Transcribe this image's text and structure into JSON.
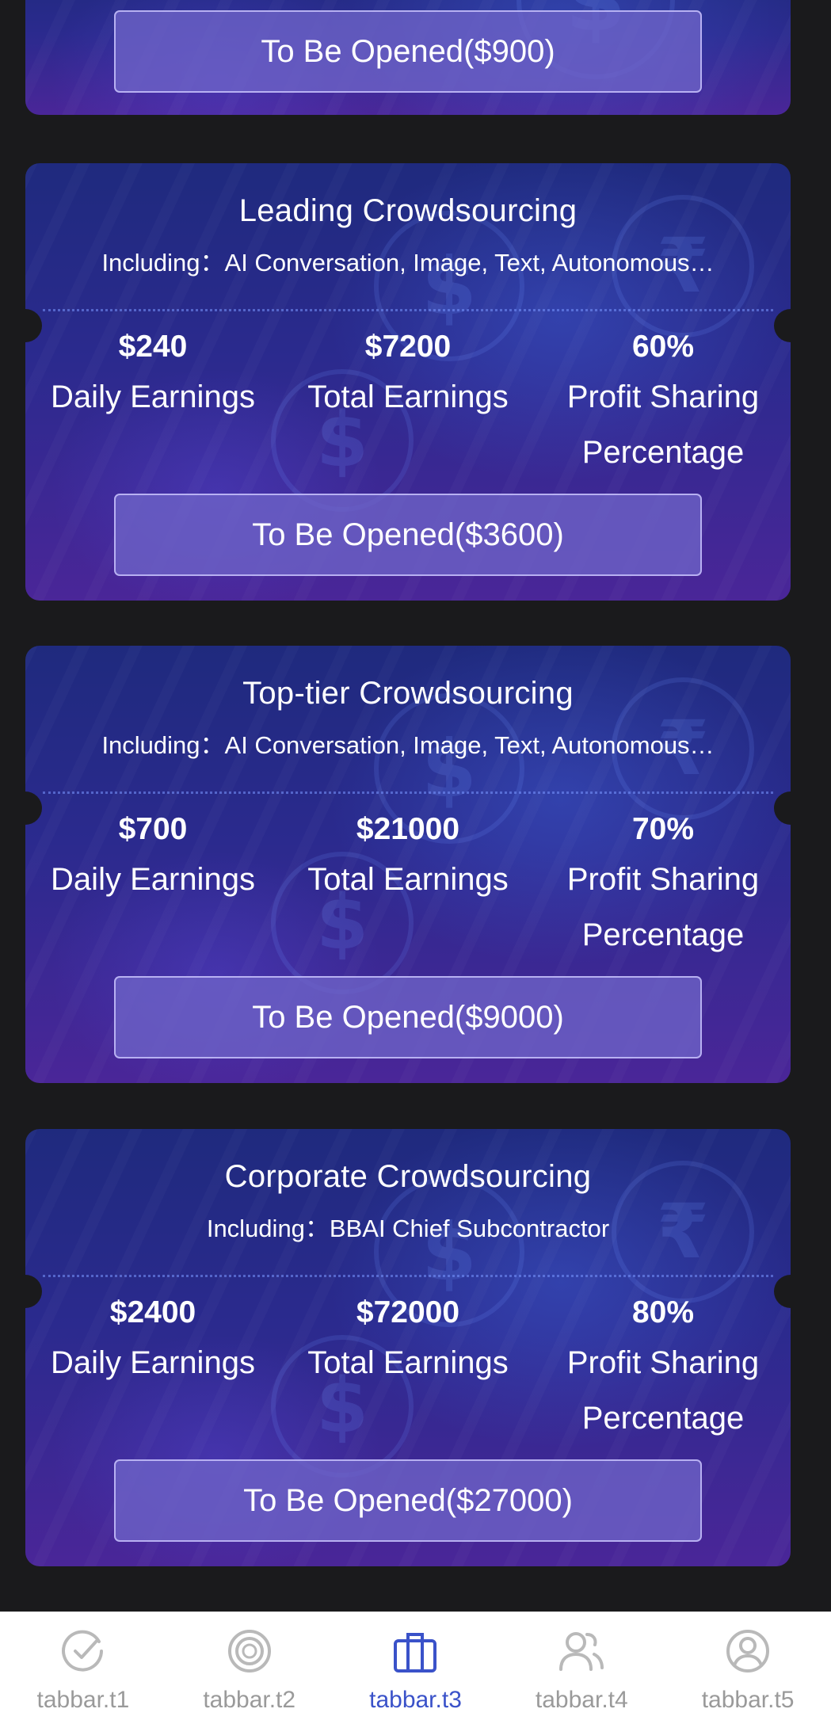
{
  "top_card": {
    "button_label": "To Be Opened($900)"
  },
  "cards": [
    {
      "title": "Leading Crowdsourcing",
      "subtitle": "Including：AI Conversation, Image, Text, Autonomous…",
      "daily_value": "$240",
      "daily_label": "Daily Earnings",
      "total_value": "$7200",
      "total_label": "Total Earnings",
      "profit_value": "60%",
      "profit_label": "Profit Sharing Percentage",
      "button_label": "To Be Opened($3600)"
    },
    {
      "title": "Top-tier Crowdsourcing",
      "subtitle": "Including：AI Conversation, Image, Text, Autonomous…",
      "daily_value": "$700",
      "daily_label": "Daily Earnings",
      "total_value": "$21000",
      "total_label": "Total Earnings",
      "profit_value": "70%",
      "profit_label": "Profit Sharing Percentage",
      "button_label": "To Be Opened($9000)"
    },
    {
      "title": "Corporate Crowdsourcing",
      "subtitle": "Including：BBAI Chief Subcontractor",
      "daily_value": "$2400",
      "daily_label": "Daily Earnings",
      "total_value": "$72000",
      "total_label": "Total Earnings",
      "profit_value": "80%",
      "profit_label": "Profit Sharing Percentage",
      "button_label": "To Be Opened($27000)"
    }
  ],
  "tabbar": {
    "tabs": [
      {
        "label": "tabbar.t1",
        "icon": "check-circle-icon"
      },
      {
        "label": "tabbar.t2",
        "icon": "target-icon"
      },
      {
        "label": "tabbar.t3",
        "icon": "briefcase-icon"
      },
      {
        "label": "tabbar.t4",
        "icon": "users-icon"
      },
      {
        "label": "tabbar.t5",
        "icon": "user-icon"
      }
    ],
    "active_index": 2,
    "active_color": "#3a52c9",
    "inactive_color": "#9a9a9a"
  },
  "colors": {
    "background": "#1a1a1c",
    "card_top": "#1f2a7e",
    "card_bottom": "#4a2698",
    "button_fill": "#6e64c8"
  }
}
